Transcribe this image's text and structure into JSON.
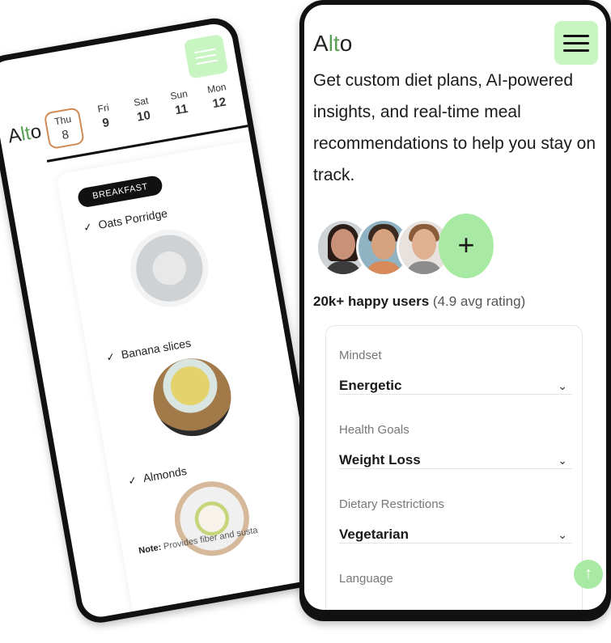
{
  "colors": {
    "accent_green": "#a8e9a3",
    "menu_green": "#c8f5c2",
    "text_dark": "#1a1a1a",
    "brand_green": "#5a9f56"
  },
  "back_phone": {
    "logo": {
      "a": "A",
      "lt": "lt",
      "o": "o"
    },
    "menu_icon": "hamburger-icon",
    "days": [
      {
        "name": "Thu",
        "date": "8",
        "selected": true
      },
      {
        "name": "Fri",
        "date": "9"
      },
      {
        "name": "Sat",
        "date": "10"
      },
      {
        "name": "Sun",
        "date": "11"
      },
      {
        "name": "Mon",
        "date": "12"
      }
    ],
    "meal_tag": "BREAKFAST",
    "meals": [
      {
        "name": "Oats Porridge",
        "check": "✓"
      },
      {
        "name": "Banana slices",
        "check": "✓"
      },
      {
        "name": "Almonds",
        "check": "✓"
      }
    ],
    "note_label": "Note:",
    "note_text": "Provides fiber and susta"
  },
  "front_phone": {
    "logo": {
      "a": "A",
      "lt": "lt",
      "o": "o"
    },
    "menu_icon": "hamburger-icon",
    "tagline": "Get custom diet plans, AI-powered insights, and real-time meal recommendations to help you stay on track.",
    "add_button": "+",
    "users_count": "20k+ happy users",
    "rating": "(4.9 avg rating)",
    "fields": [
      {
        "label": "Mindset",
        "value": "Energetic"
      },
      {
        "label": "Health Goals",
        "value": "Weight Loss"
      },
      {
        "label": "Dietary Restrictions",
        "value": "Vegetarian"
      },
      {
        "label": "Language",
        "value": ""
      }
    ],
    "chevron": "⌄",
    "scroll_top": "↑"
  }
}
